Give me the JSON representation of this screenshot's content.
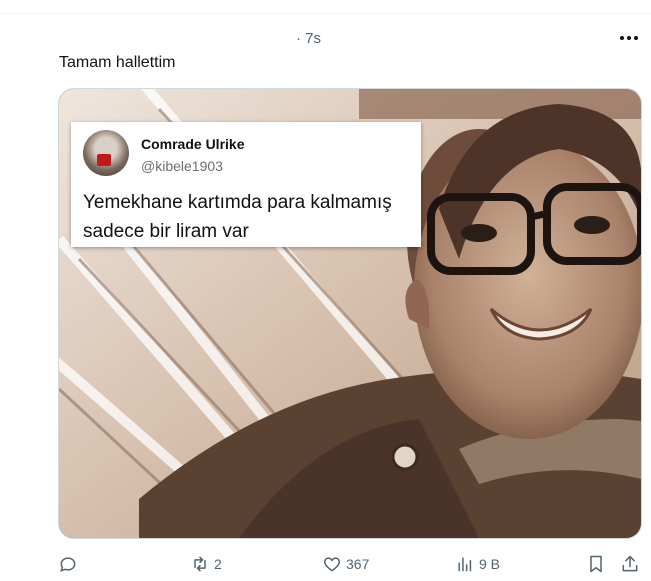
{
  "post": {
    "timestamp": "· 7s",
    "text": "Tamam hallettim"
  },
  "quoted_tweet": {
    "name": "Comrade Ulrike",
    "handle": "@kibele1903",
    "text": "Yemekhane kartımda para kalmamış sadece bir liram var"
  },
  "actions": {
    "reply_count": "",
    "retweet_count": "2",
    "like_count": "367",
    "views_count": "9 B"
  },
  "colors": {
    "text_primary": "#0f1419",
    "text_secondary": "#536471",
    "border": "#cfd9de"
  },
  "icons": {
    "more": "more-horizontal-icon",
    "reply": "reply-icon",
    "retweet": "retweet-icon",
    "like": "heart-icon",
    "views": "views-icon",
    "bookmark": "bookmark-icon",
    "share": "share-icon"
  }
}
